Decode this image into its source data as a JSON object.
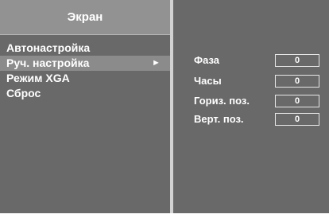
{
  "menu": {
    "title": "Экран",
    "items": [
      {
        "label": "Автонастройка",
        "selected": false,
        "arrow": ""
      },
      {
        "label": "Руч. настройка",
        "selected": true,
        "arrow": "►"
      },
      {
        "label": "Режим XGA",
        "selected": false,
        "arrow": ""
      },
      {
        "label": "Сброс",
        "selected": false,
        "arrow": ""
      }
    ]
  },
  "submenu": {
    "params": [
      {
        "label": "Фаза",
        "value": "0"
      },
      {
        "label": "Часы",
        "value": "0"
      },
      {
        "label": "Гориз. поз.",
        "value": "0"
      },
      {
        "label": "Верт. поз.",
        "value": "0"
      }
    ]
  },
  "colors": {
    "panel_bg": "#696969",
    "header_bg": "#929292",
    "selected_bg": "#8b8b8b",
    "divider": "#d2d2d2",
    "text": "#ffffff"
  }
}
